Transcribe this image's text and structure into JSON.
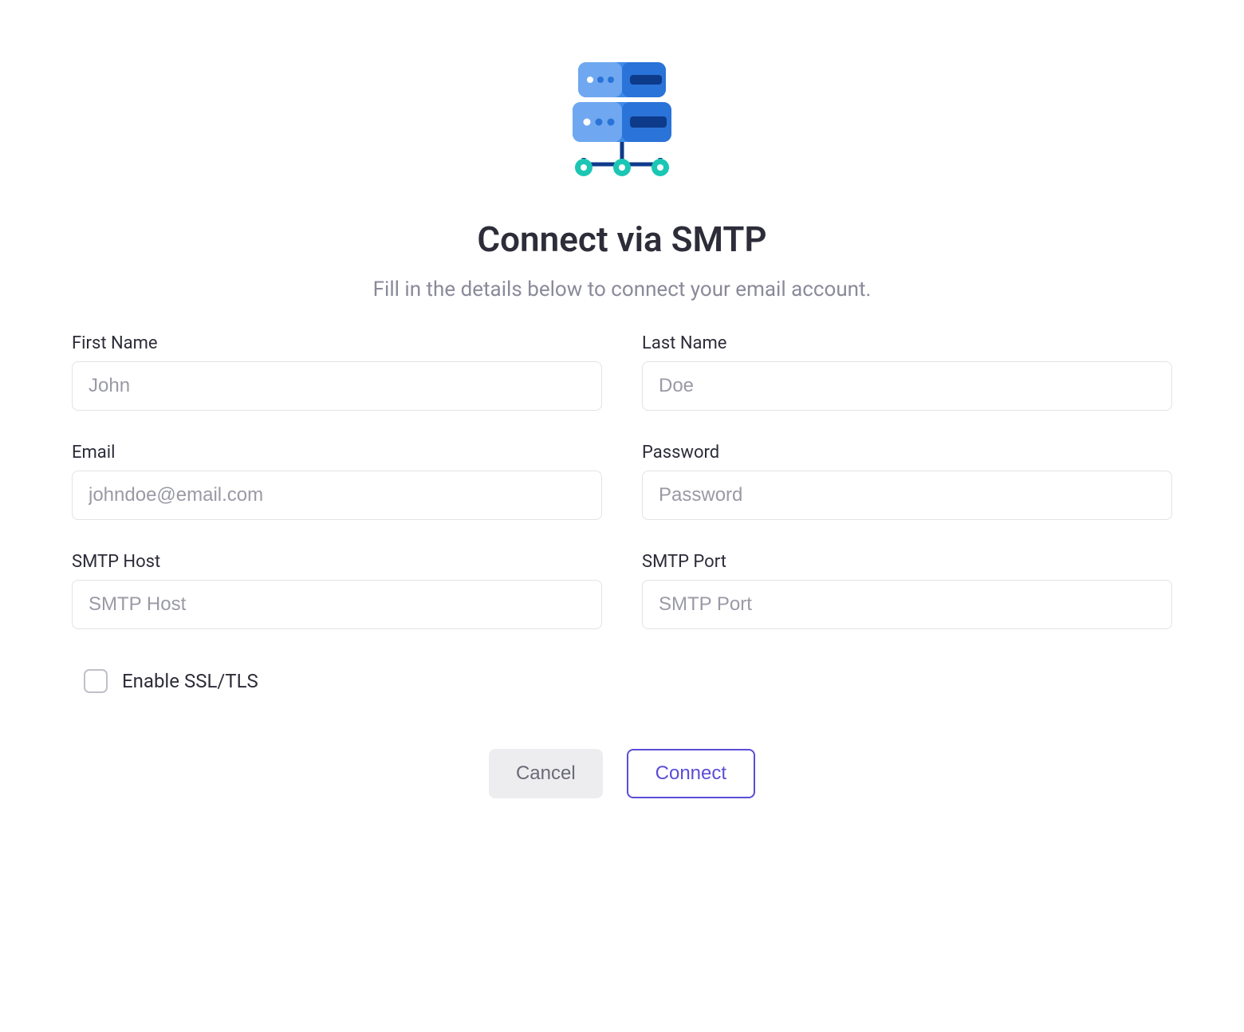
{
  "heading": {
    "title": "Connect via SMTP",
    "subtitle": "Fill in the details below to connect your email account."
  },
  "form": {
    "first_name": {
      "label": "First Name",
      "placeholder": "John",
      "value": ""
    },
    "last_name": {
      "label": "Last Name",
      "placeholder": "Doe",
      "value": ""
    },
    "email": {
      "label": "Email",
      "placeholder": "johndoe@email.com",
      "value": ""
    },
    "password": {
      "label": "Password",
      "placeholder": "Password",
      "value": ""
    },
    "smtp_host": {
      "label": "SMTP Host",
      "placeholder": "SMTP Host",
      "value": ""
    },
    "smtp_port": {
      "label": "SMTP Port",
      "placeholder": "SMTP Port",
      "value": ""
    }
  },
  "checkbox": {
    "ssl_label": "Enable SSL/TLS",
    "checked": false
  },
  "buttons": {
    "cancel": "Cancel",
    "connect": "Connect"
  },
  "icon": {
    "name": "server-icon"
  },
  "colors": {
    "accent": "#5a4dd6",
    "server_light": "#4a93ea",
    "server_dark": "#1d5fd8",
    "server_darker": "#1242a8",
    "node": "#1bc7b4"
  }
}
